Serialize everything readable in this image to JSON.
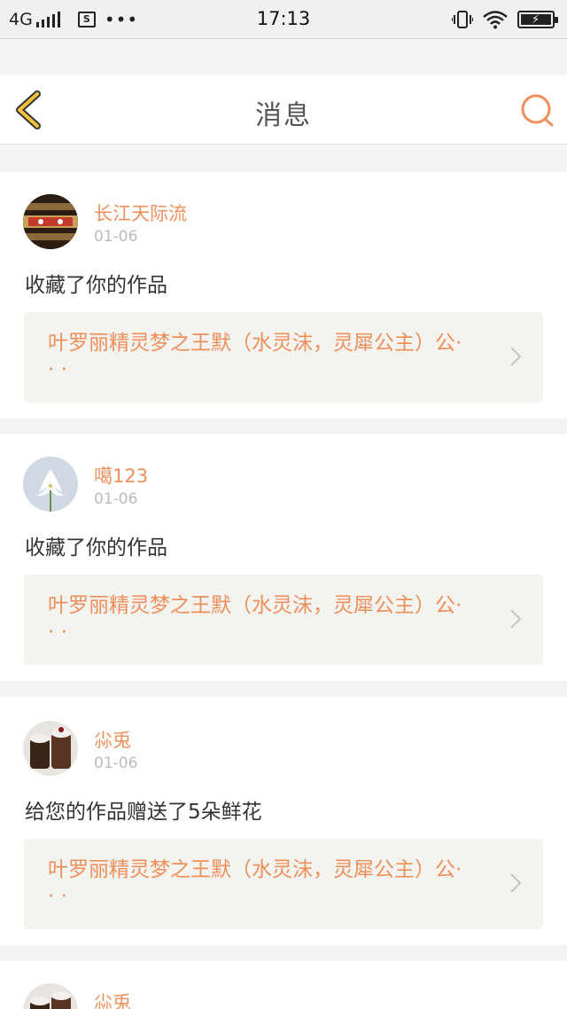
{
  "status_bar": {
    "network": "4G",
    "time": "17:13",
    "dots": "•••",
    "sim_icon_label": "S"
  },
  "header": {
    "title": "消息"
  },
  "colors": {
    "accent": "#ef8f5c",
    "back_arrow": "#f3c13a",
    "work_box_bg": "#f3f3ef"
  },
  "messages": [
    {
      "username": "长江天际流",
      "date": "01-06",
      "action": "收藏了你的作品",
      "work_title": "叶罗丽精灵梦之王默（水灵沫，灵犀公主）公· · ·"
    },
    {
      "username": "噶123",
      "date": "01-06",
      "action": "收藏了你的作品",
      "work_title": "叶罗丽精灵梦之王默（水灵沫，灵犀公主）公· · ·"
    },
    {
      "username": "尛兎",
      "date": "01-06",
      "action": "给您的作品赠送了5朵鲜花",
      "work_title": "叶罗丽精灵梦之王默（水灵沫，灵犀公主）公· · ·"
    },
    {
      "username": "尛兎"
    }
  ]
}
